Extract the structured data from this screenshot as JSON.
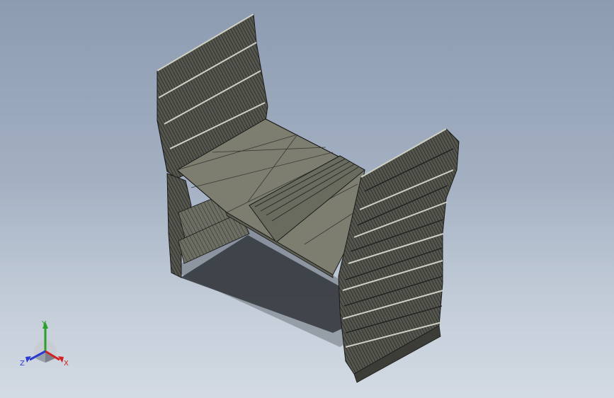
{
  "viewport": {
    "background_top": "#8d9bb1",
    "background_bottom": "#d3dae3"
  },
  "model": {
    "face_color": "#7d7e70",
    "dark_face_color": "#4e4f48",
    "edge_color": "#1a1a1a"
  },
  "triad": {
    "x_label": "X",
    "y_label": "Y",
    "z_label": "Z",
    "x_color": "#d52020",
    "y_color": "#2aa02a",
    "z_color": "#2a3ad0"
  }
}
